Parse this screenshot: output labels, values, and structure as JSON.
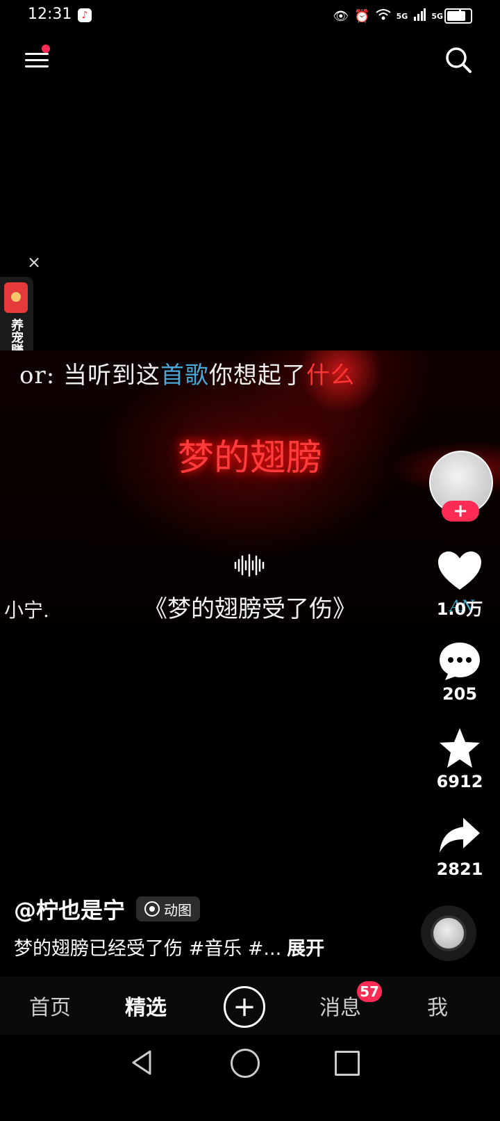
{
  "status_bar": {
    "time": "12:31",
    "icons": [
      "music-app-icon",
      "eye-icon",
      "alarm-icon",
      "wifi-icon",
      "signal-5g-icon",
      "signal-5g-icon",
      "battery-icon"
    ],
    "net1": "5G",
    "net2": "5G"
  },
  "side_widget": {
    "close": "×",
    "text": "养宠赚红包"
  },
  "video": {
    "lyric_prefix": "or: 当听到这",
    "lyric_highlight": "首歌",
    "lyric_mid": "你想起了",
    "lyric_red": "什么",
    "neon_title": "梦的翅膀",
    "song_title": "《梦的翅膀受了伤》",
    "left_name": "小宁.",
    "right_mark": "AN"
  },
  "actions": {
    "follow": "+",
    "like_count": "1.0万",
    "comment_count": "205",
    "favorite_count": "6912",
    "share_count": "2821"
  },
  "caption": {
    "author": "@柠也是宁",
    "badge": "动图",
    "text": "梦的翅膀已经受了伤 #音乐 #...",
    "expand": "展开"
  },
  "bottom_nav": {
    "home": "首页",
    "featured": "精选",
    "add": "+",
    "messages": "消息",
    "messages_badge": "57",
    "me": "我"
  },
  "colors": {
    "accent": "#fe2c55",
    "neon_red": "#ff3b3b",
    "lyric_highlight": "#4aa8d8"
  }
}
